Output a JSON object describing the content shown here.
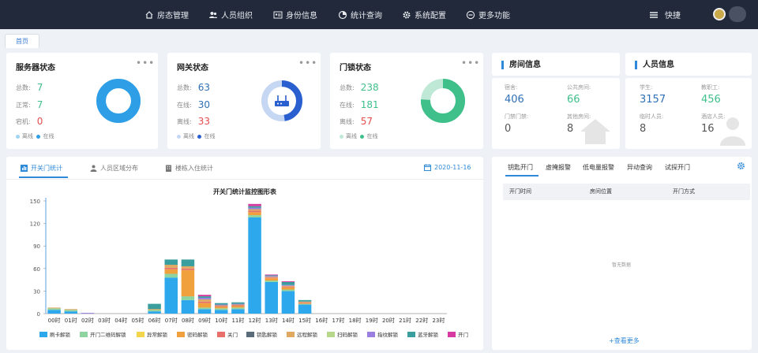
{
  "nav": {
    "items": [
      {
        "label": "房态管理",
        "icon": "home-icon"
      },
      {
        "label": "人员组织",
        "icon": "people-icon"
      },
      {
        "label": "身份信息",
        "icon": "id-card-icon"
      },
      {
        "label": "统计查询",
        "icon": "pie-chart-icon"
      },
      {
        "label": "系统配置",
        "icon": "gear-icon"
      },
      {
        "label": "更多功能",
        "icon": "minus-circle-icon"
      }
    ],
    "quick_label": "快捷",
    "avatar": "avatar"
  },
  "tabs": {
    "home": "首页"
  },
  "server_status": {
    "title": "服务器状态",
    "rows": [
      {
        "label": "总数:",
        "value": "7"
      },
      {
        "label": "正常:",
        "value": "7"
      },
      {
        "label": "宕机:",
        "value": "0"
      }
    ],
    "legend": [
      "离线",
      "在线"
    ],
    "online_fraction": 1.0,
    "colors": {
      "online": "#2e9fe6",
      "offline": "#9fd6f4"
    }
  },
  "gateway_status": {
    "title": "网关状态",
    "rows": [
      {
        "label": "总数:",
        "value": "63"
      },
      {
        "label": "在线:",
        "value": "30"
      },
      {
        "label": "离线:",
        "value": "33"
      }
    ],
    "legend": [
      "离线",
      "在线"
    ],
    "online_fraction": 0.476,
    "colors": {
      "online": "#2a5fd0",
      "offline": "#c6d7f3"
    }
  },
  "lock_status": {
    "title": "门锁状态",
    "rows": [
      {
        "label": "总数:",
        "value": "238"
      },
      {
        "label": "在线:",
        "value": "181"
      },
      {
        "label": "离线:",
        "value": "57"
      }
    ],
    "legend": [
      "离线",
      "在线"
    ],
    "online_fraction": 0.76,
    "colors": {
      "online": "#3fbf8a",
      "offline": "#bfe9d6"
    }
  },
  "room_info": {
    "title": "房间信息",
    "cells": [
      {
        "label": "宿舍:",
        "value": "406",
        "color": "#2e6fb5"
      },
      {
        "label": "公共房间:",
        "value": "66",
        "color": "#3fbf8a"
      },
      {
        "label": "门禁门禁:",
        "value": "0",
        "color": "#555"
      },
      {
        "label": "其他房间:",
        "value": "8",
        "color": "#555"
      }
    ]
  },
  "people_info": {
    "title": "人员信息",
    "cells": [
      {
        "label": "学生:",
        "value": "3157",
        "color": "#2e6fb5"
      },
      {
        "label": "教职工:",
        "value": "456",
        "color": "#3fbf8a"
      },
      {
        "label": "临时人员:",
        "value": "8",
        "color": "#555"
      },
      {
        "label": "酒店人员:",
        "value": "16",
        "color": "#555"
      }
    ]
  },
  "chart_panel": {
    "tabs": [
      {
        "label": "开关门统计",
        "icon": "chart-icon"
      },
      {
        "label": "人员区域分布",
        "icon": "people-icon"
      },
      {
        "label": "楼栋入住统计",
        "icon": "building-icon"
      }
    ],
    "date": "2020-11-16"
  },
  "chart_data": {
    "type": "bar",
    "stacked": true,
    "title": "开关门统计监控图形表",
    "categories": [
      "00时",
      "01时",
      "02时",
      "03时",
      "04时",
      "05时",
      "06时",
      "07时",
      "08时",
      "09时",
      "10时",
      "11时",
      "12时",
      "13时",
      "14时",
      "15时",
      "16时",
      "17时",
      "18时",
      "19时",
      "20时",
      "21时",
      "22时",
      "23时"
    ],
    "ylim": [
      0,
      150
    ],
    "yticks": [
      0,
      30,
      60,
      90,
      120,
      150
    ],
    "series": [
      {
        "name": "刷卡解锁",
        "color": "#2ea8ec",
        "values": [
          5,
          3,
          0,
          0,
          0,
          0,
          3,
          48,
          18,
          6,
          5,
          6,
          128,
          42,
          30,
          12,
          0,
          0,
          0,
          0,
          0,
          0,
          0,
          0
        ]
      },
      {
        "name": "开门二维码解锁",
        "color": "#8fd3a0",
        "values": [
          2,
          2,
          0,
          0,
          0,
          0,
          2,
          5,
          5,
          2,
          2,
          2,
          3,
          2,
          2,
          1,
          0,
          0,
          0,
          0,
          0,
          0,
          0,
          0
        ]
      },
      {
        "name": "异常解锁",
        "color": "#f2d54a",
        "values": [
          0,
          0,
          0,
          0,
          0,
          0,
          0,
          0,
          0,
          0,
          0,
          0,
          0,
          0,
          0,
          0,
          0,
          0,
          0,
          0,
          0,
          0,
          0,
          0
        ]
      },
      {
        "name": "密码解锁",
        "color": "#f0a03c",
        "values": [
          0,
          0,
          0,
          0,
          0,
          0,
          1,
          6,
          35,
          6,
          2,
          2,
          4,
          3,
          3,
          1,
          0,
          0,
          0,
          0,
          0,
          0,
          0,
          0
        ]
      },
      {
        "name": "关门",
        "color": "#e8706a",
        "values": [
          0,
          0,
          0,
          0,
          0,
          0,
          0,
          2,
          2,
          2,
          1,
          1,
          2,
          1,
          1,
          1,
          0,
          0,
          0,
          0,
          0,
          0,
          0,
          0
        ]
      },
      {
        "name": "钥匙解锁",
        "color": "#5a6b7a",
        "values": [
          0,
          0,
          0,
          0,
          0,
          0,
          0,
          0,
          0,
          0,
          0,
          0,
          0,
          0,
          0,
          0,
          0,
          0,
          0,
          0,
          0,
          0,
          0,
          0
        ]
      },
      {
        "name": "远程解锁",
        "color": "#e0a860",
        "values": [
          1,
          1,
          0,
          0,
          0,
          0,
          0,
          4,
          3,
          3,
          1,
          1,
          2,
          1,
          1,
          1,
          0,
          0,
          0,
          0,
          0,
          0,
          0,
          0
        ]
      },
      {
        "name": "扫码解锁",
        "color": "#b7d88a",
        "values": [
          0,
          0,
          0,
          0,
          0,
          0,
          0,
          0,
          0,
          0,
          0,
          0,
          0,
          0,
          0,
          0,
          0,
          0,
          0,
          0,
          0,
          0,
          0,
          0
        ]
      },
      {
        "name": "指纹解锁",
        "color": "#9a7fe0",
        "values": [
          0,
          0,
          1,
          0,
          0,
          0,
          0,
          0,
          0,
          2,
          1,
          1,
          2,
          1,
          1,
          0,
          0,
          0,
          0,
          0,
          0,
          0,
          0,
          0
        ]
      },
      {
        "name": "蓝牙解锁",
        "color": "#3a9e9e",
        "values": [
          0,
          0,
          0,
          0,
          0,
          0,
          7,
          7,
          9,
          2,
          2,
          2,
          2,
          1,
          4,
          2,
          0,
          0,
          0,
          0,
          0,
          0,
          0,
          0
        ]
      },
      {
        "name": "开门",
        "color": "#d63aa0",
        "values": [
          0,
          0,
          0,
          0,
          0,
          0,
          0,
          0,
          0,
          2,
          0,
          0,
          3,
          1,
          1,
          0,
          0,
          0,
          0,
          0,
          0,
          0,
          0,
          0
        ]
      }
    ]
  },
  "records_panel": {
    "tabs": [
      "钥匙开门",
      "虚掩报警",
      "低电量报警",
      "异动查询",
      "试探开门"
    ],
    "columns": [
      "开门时间",
      "房间位置",
      "开门方式"
    ],
    "empty_text": "暂无数据",
    "more_label": "+查看更多",
    "accent": "#2e89d8"
  }
}
